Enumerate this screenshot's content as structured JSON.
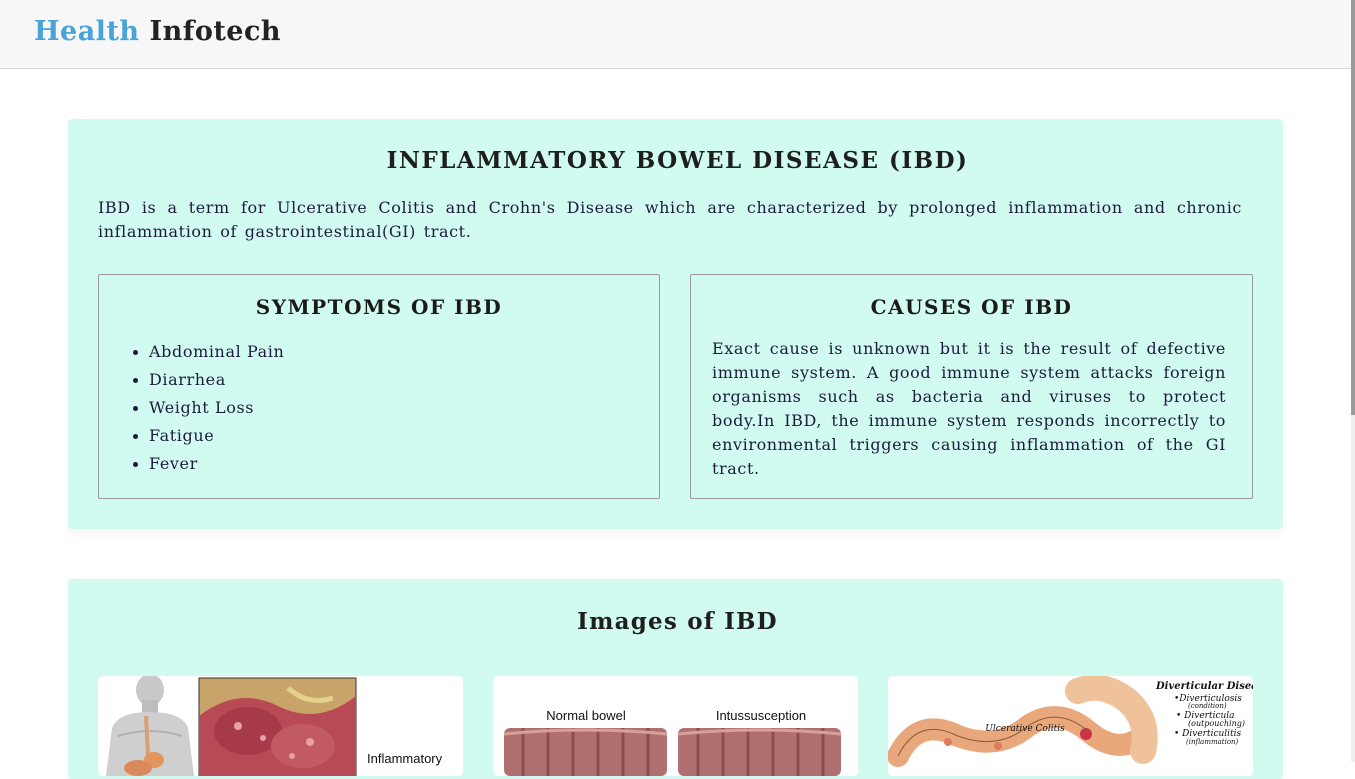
{
  "navbar": {
    "brand_first": "Health",
    "brand_second": "Infotech",
    "brand_accent_color": "#4aa3d8"
  },
  "ibd": {
    "title": "INFLAMMATORY BOWEL DISEASE (IBD)",
    "intro": "IBD is a term for Ulcerative Colitis and Crohn's Disease which are characterized by prolonged inflammation and chronic inflammation of gastrointestinal(GI) tract.",
    "symptoms": {
      "title": "SYMPTOMS OF IBD",
      "items": [
        "Abdominal Pain",
        "Diarrhea",
        "Weight Loss",
        "Fatigue",
        "Fever"
      ]
    },
    "causes": {
      "title": "CAUSES OF IBD",
      "text": "Exact cause is unknown but it is the result of defective immune system. A good immune system attacks foreign organisms such as bacteria and viruses to protect body.In IBD, the immune system responds incorrectly to environmental triggers causing inflammation of the GI tract."
    }
  },
  "images_section": {
    "title": "Images of IBD",
    "image1": {
      "label": "Inflammatory"
    },
    "image2": {
      "label_left": "Normal bowel",
      "label_right": "Intussusception"
    },
    "image3": {
      "title": "Diverticular Disease",
      "lines": [
        "•Diverticulosis",
        "(condition)",
        "• Diverticula",
        "(outpouching)",
        "• Diverticulitis",
        "(inflammation)"
      ],
      "label": "Ulcerative Colitis"
    }
  },
  "colors": {
    "card_background": "#d1fbf1",
    "navbar_background": "#f7f7f7"
  }
}
